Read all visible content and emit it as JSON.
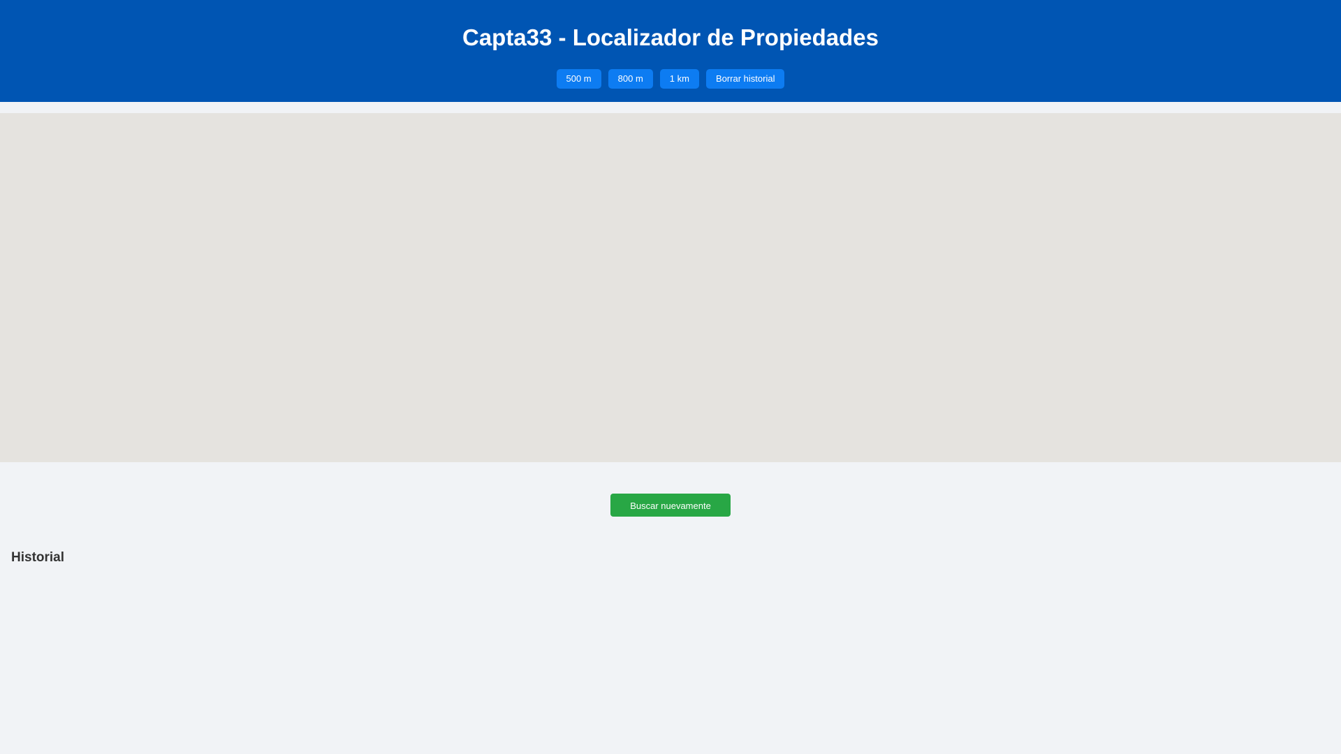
{
  "header": {
    "title": "Capta33 - Localizador de Propiedades",
    "buttons": [
      {
        "label": "500 m"
      },
      {
        "label": "800 m"
      },
      {
        "label": "1 km"
      },
      {
        "label": "Borrar historial"
      }
    ]
  },
  "map": {},
  "actions": {
    "search_again_label": "Buscar nuevamente"
  },
  "history": {
    "title": "Historial",
    "items": []
  },
  "colors": {
    "header_bg": "#0055b3",
    "primary_button": "#0d7cf2",
    "success_button": "#28a745",
    "page_bg": "#f1f3f6",
    "map_bg": "#e5e3df"
  }
}
